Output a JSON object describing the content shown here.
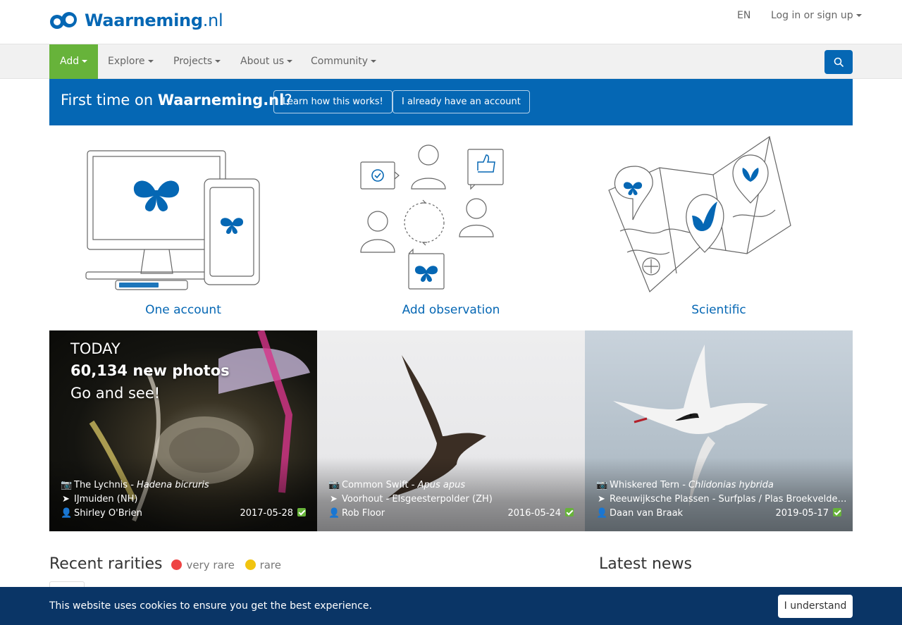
{
  "header": {
    "logo_main": "Waarneming",
    "logo_tld": ".nl",
    "language": "EN",
    "login": "Log in or sign up"
  },
  "nav": {
    "add": "Add",
    "explore": "Explore",
    "projects": "Projects",
    "about": "About us",
    "community": "Community",
    "search_icon": "search-icon"
  },
  "banner": {
    "prefix": "First time on ",
    "site": "Waarneming.nl",
    "suffix": "?",
    "learn_button": "Learn how this works!",
    "account_button": "I already have an account"
  },
  "features": [
    {
      "label": "One account",
      "icon": "devices-butterfly-illustration"
    },
    {
      "label": "Add observation",
      "icon": "community-cycle-illustration"
    },
    {
      "label": "Scientific",
      "icon": "map-pins-illustration"
    }
  ],
  "photos": [
    {
      "today": "TODAY",
      "count_text": "60,134 new photos",
      "cta": "Go and see!",
      "species_common": "The Lychnis - ",
      "species_latin": "Hadena bicruris",
      "location": "IJmuiden (NH)",
      "observer": "Shirley O'Brien",
      "date": "2017-05-28"
    },
    {
      "species_common": "Common Swift - ",
      "species_latin": "Apus apus",
      "location": "Voorhout - Elsgeesterpolder (ZH)",
      "observer": "Rob Floor",
      "date": "2016-05-24"
    },
    {
      "species_common": "Whiskered Tern - ",
      "species_latin": "Chlidonias hybrida",
      "location": "Reeuwijksche Plassen - Surfplas / Plas Broekvelde…",
      "observer": "Daan van Braak",
      "date": "2019-05-17"
    }
  ],
  "sections": {
    "rarities_title": "Recent rarities",
    "very_rare": "very rare",
    "rare": "rare",
    "news_title": "Latest news"
  },
  "cookie": {
    "text": "This website uses cookies to ensure you get the best experience.",
    "button": "I understand"
  },
  "colors": {
    "brand_blue": "#0567b4",
    "add_green": "#67b33a",
    "cookie_bg": "#0a3566",
    "very_rare": "#e44444",
    "rare": "#f1c40f"
  }
}
